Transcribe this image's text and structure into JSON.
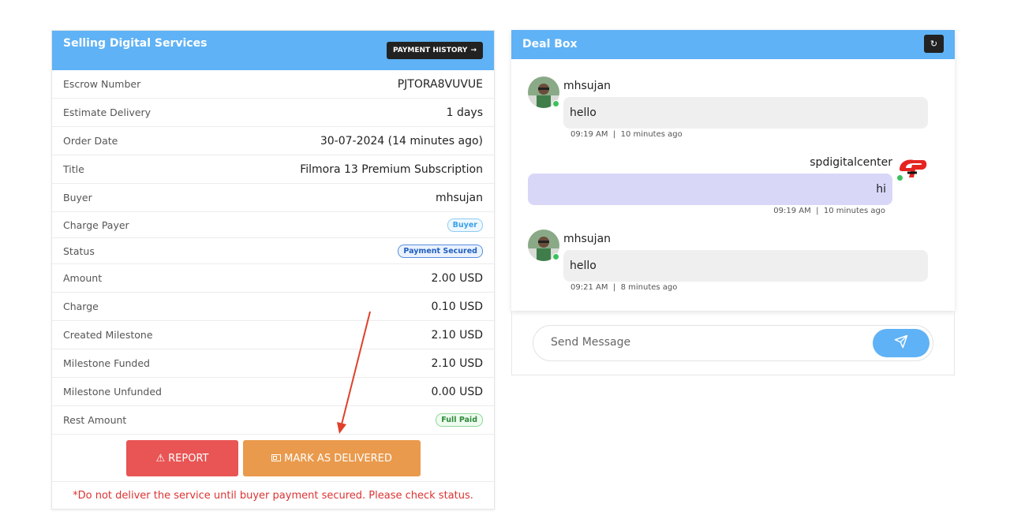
{
  "left_panel": {
    "title": "Selling Digital Services",
    "history_button": "PAYMENT HISTORY",
    "rows": [
      {
        "label": "Escrow Number",
        "value": "PJTORA8VUVUE"
      },
      {
        "label": "Estimate Delivery",
        "value": "1 days"
      },
      {
        "label": "Order Date",
        "value": "30-07-2024 (14 minutes ago)"
      },
      {
        "label": "Title",
        "value": "Filmora 13 Premium Subscription"
      },
      {
        "label": "Buyer",
        "value": "mhsujan"
      },
      {
        "label": "Charge Payer",
        "badge": "Buyer"
      },
      {
        "label": "Status",
        "badge": "Payment Secured"
      },
      {
        "label": "Amount",
        "value": "2.00 USD"
      },
      {
        "label": "Charge",
        "value": "0.10 USD"
      },
      {
        "label": "Created Milestone",
        "value": "2.10 USD"
      },
      {
        "label": "Milestone Funded",
        "value": "2.10 USD"
      },
      {
        "label": "Milestone Unfunded",
        "value": "0.00 USD"
      },
      {
        "label": "Rest Amount",
        "badge": "Full Paid"
      }
    ],
    "report_button": "REPORT",
    "deliver_button": "MARK AS DELIVERED",
    "warning": "*Do not deliver the service until buyer payment secured. Please check status."
  },
  "deal_box": {
    "title": "Deal Box",
    "messages": [
      {
        "sender": "mhsujan",
        "text": "hello",
        "time": "09:19 AM",
        "ago": "10 minutes ago",
        "direction": "in"
      },
      {
        "sender": "spdigitalcenter",
        "text": "hi",
        "time": "09:19 AM",
        "ago": "10 minutes ago",
        "direction": "out"
      },
      {
        "sender": "mhsujan",
        "text": "hello",
        "time": "09:21 AM",
        "ago": "8 minutes ago",
        "direction": "in"
      }
    ],
    "send_placeholder": "Send Message"
  },
  "colors": {
    "header_blue": "#5fb2f5",
    "report_red": "#e85554",
    "deliver_orange": "#ea9a4c",
    "warning_red": "#dc3333",
    "outgoing_bubble": "#d8d7f8",
    "incoming_bubble": "#efefef"
  }
}
